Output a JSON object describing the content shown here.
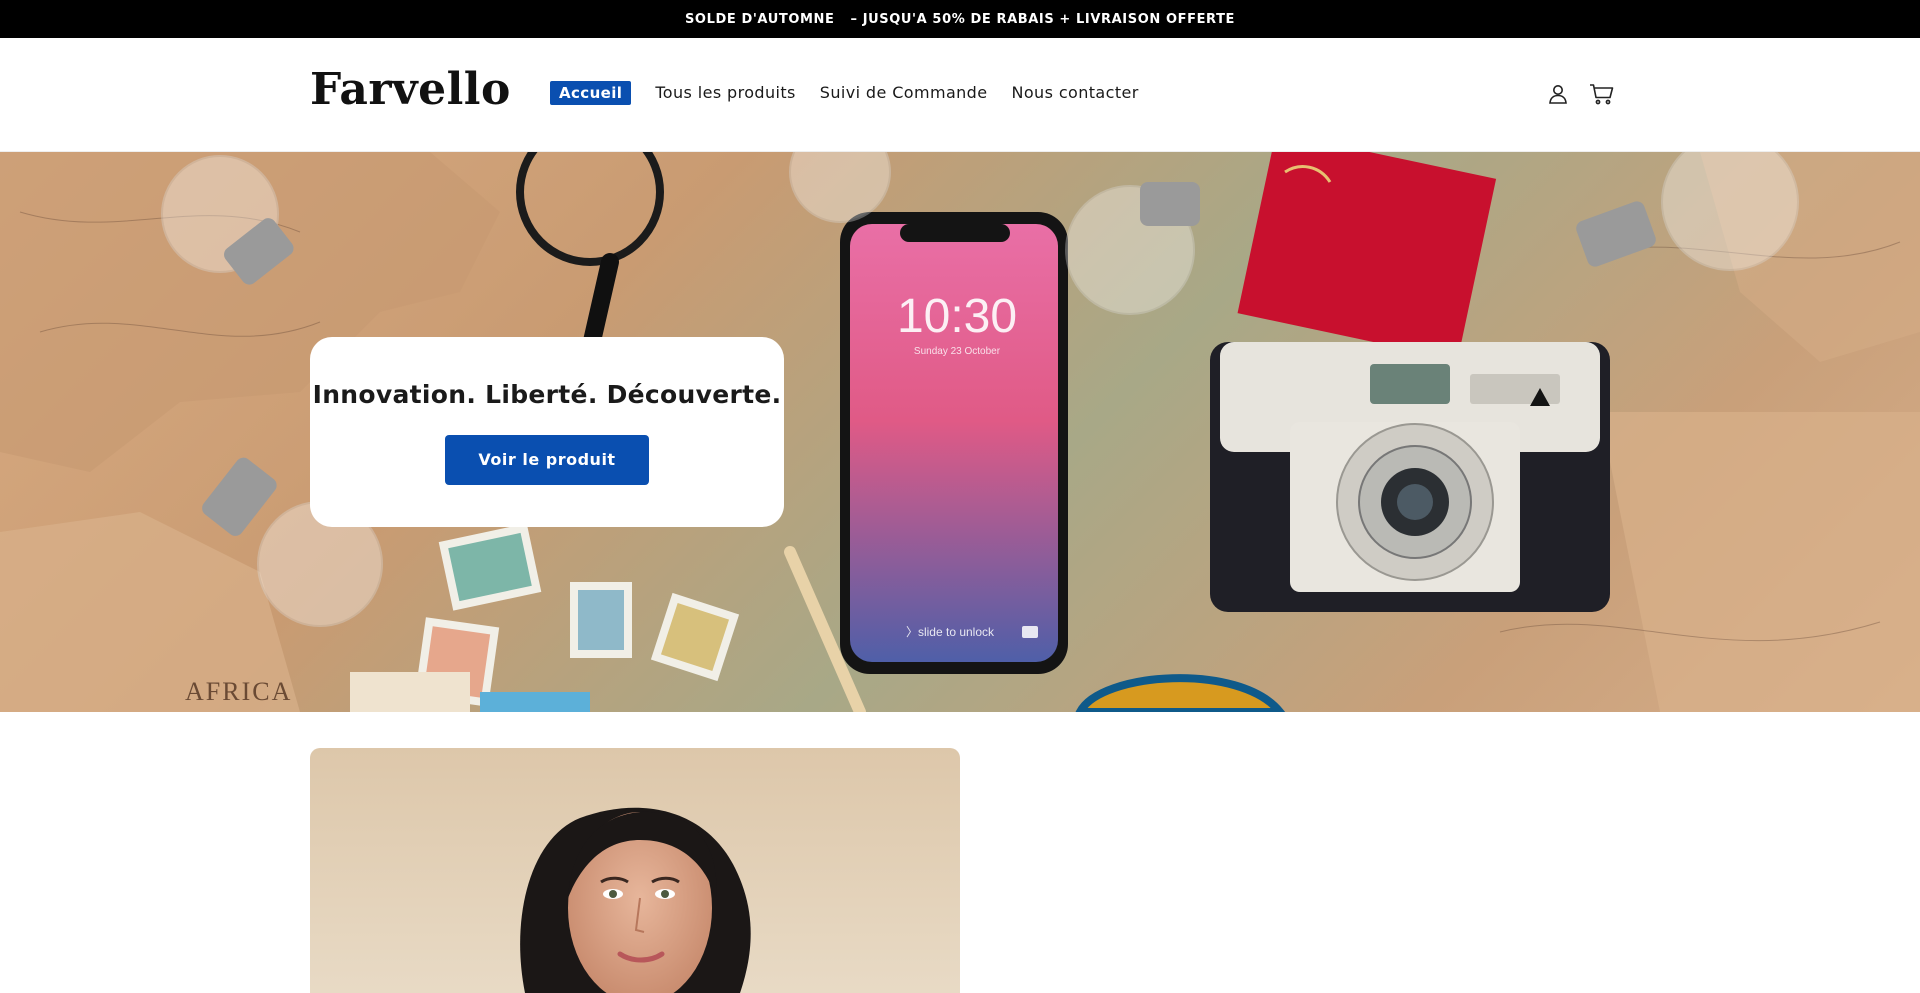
{
  "announcement": {
    "part1": "SOLDE D'AUTOMNE",
    "part2": "– JUSQU'A 50% DE RABAIS + LIVRAISON OFFERTE"
  },
  "header": {
    "logo": "Farvello",
    "nav": [
      {
        "label": "Accueil",
        "active": true
      },
      {
        "label": "Tous les produits"
      },
      {
        "label": "Suivi de Commande"
      },
      {
        "label": "Nous contacter"
      }
    ],
    "icons": [
      "account-icon",
      "cart-icon"
    ]
  },
  "hero": {
    "title": "Innovation. Liberté. Découverte.",
    "button": "Voir le produit",
    "phone_time": "10:30",
    "phone_date": "Sunday 23 October",
    "phone_unlock": "〉slide to unlock",
    "map_label": "AFRICA"
  },
  "colors": {
    "accent": "#0a4fb0",
    "topbar": "#000000"
  }
}
